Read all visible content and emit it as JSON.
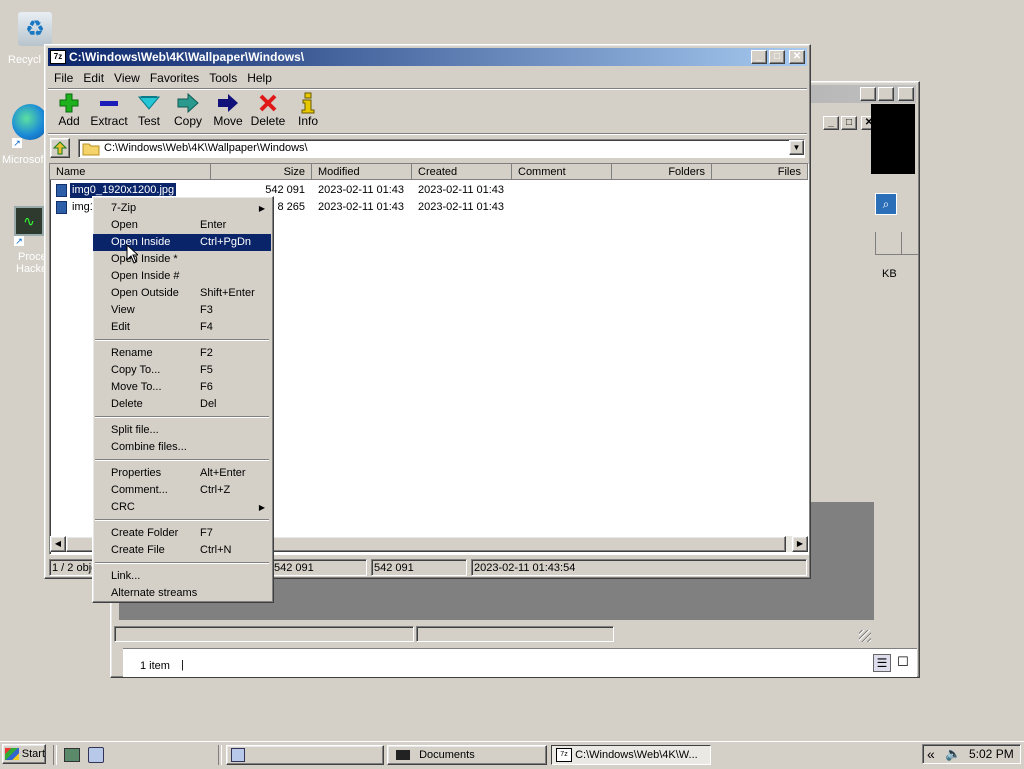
{
  "desktop": {
    "icons": [
      {
        "label": "Recycl"
      },
      {
        "label": "Microsof"
      },
      {
        "label": "Proce"
      },
      {
        "label": "Hacke"
      }
    ]
  },
  "explorer_window": {
    "kb_text": "KB",
    "status_count": "1 item",
    "status_cursor": "|"
  },
  "zip_window": {
    "title": "C:\\Windows\\Web\\4K\\Wallpaper\\Windows\\",
    "title_icon": "7z",
    "menu": [
      "File",
      "Edit",
      "View",
      "Favorites",
      "Tools",
      "Help"
    ],
    "toolbar": [
      {
        "label": "Add",
        "icon": "add-icon",
        "color": "#1db21d"
      },
      {
        "label": "Extract",
        "icon": "extract-icon",
        "color": "#1c1cb8"
      },
      {
        "label": "Test",
        "icon": "test-icon",
        "color": "#24c6d6"
      },
      {
        "label": "Copy",
        "icon": "copy-icon",
        "color": "#2a9a8e"
      },
      {
        "label": "Move",
        "icon": "move-icon",
        "color": "#11117a"
      },
      {
        "label": "Delete",
        "icon": "delete-icon",
        "color": "#e01818"
      },
      {
        "label": "Info",
        "icon": "info-icon",
        "color": "#e8c800"
      }
    ],
    "address": "C:\\Windows\\Web\\4K\\Wallpaper\\Windows\\",
    "columns": [
      "Name",
      "Size",
      "Modified",
      "Created",
      "Comment",
      "Folders",
      "Files"
    ],
    "rows": [
      {
        "name": "img0_1920x1200.jpg",
        "size": "542 091",
        "modified": "2023-02-11 01:43",
        "created": "2023-02-11 01:43",
        "selected": true
      },
      {
        "name": "img1",
        "size": "8 265",
        "modified": "2023-02-11 01:43",
        "created": "2023-02-11 01:43",
        "selected": false
      }
    ],
    "status": [
      "1 / 2 obje",
      "542 091",
      "542 091",
      "2023-02-11 01:43:54"
    ]
  },
  "context_menu": {
    "groups": [
      [
        {
          "label": "7-Zip",
          "shortcut": "",
          "submenu": true
        },
        {
          "label": "Open",
          "shortcut": "Enter"
        },
        {
          "label": "Open Inside",
          "shortcut": "Ctrl+PgDn",
          "highlighted": true
        },
        {
          "label": "Open Inside *",
          "shortcut": ""
        },
        {
          "label": "Open Inside #",
          "shortcut": ""
        },
        {
          "label": "Open Outside",
          "shortcut": "Shift+Enter"
        },
        {
          "label": "View",
          "shortcut": "F3"
        },
        {
          "label": "Edit",
          "shortcut": "F4"
        }
      ],
      [
        {
          "label": "Rename",
          "shortcut": "F2"
        },
        {
          "label": "Copy To...",
          "shortcut": "F5"
        },
        {
          "label": "Move To...",
          "shortcut": "F6"
        },
        {
          "label": "Delete",
          "shortcut": "Del"
        }
      ],
      [
        {
          "label": "Split file...",
          "shortcut": ""
        },
        {
          "label": "Combine files...",
          "shortcut": ""
        }
      ],
      [
        {
          "label": "Properties",
          "shortcut": "Alt+Enter"
        },
        {
          "label": "Comment...",
          "shortcut": "Ctrl+Z"
        },
        {
          "label": "CRC",
          "shortcut": "",
          "submenu": true
        }
      ],
      [
        {
          "label": "Create Folder",
          "shortcut": "F7"
        },
        {
          "label": "Create File",
          "shortcut": "Ctrl+N"
        }
      ],
      [
        {
          "label": "Link...",
          "shortcut": ""
        },
        {
          "label": "Alternate streams",
          "shortcut": ""
        }
      ]
    ]
  },
  "taskbar": {
    "start_label": "Start",
    "tasks": [
      {
        "label": ""
      },
      {
        "label": "Documents"
      },
      {
        "label": "C:\\Windows\\Web\\4K\\W..."
      }
    ],
    "tray_chevron": "«",
    "clock": "5:02 PM"
  }
}
